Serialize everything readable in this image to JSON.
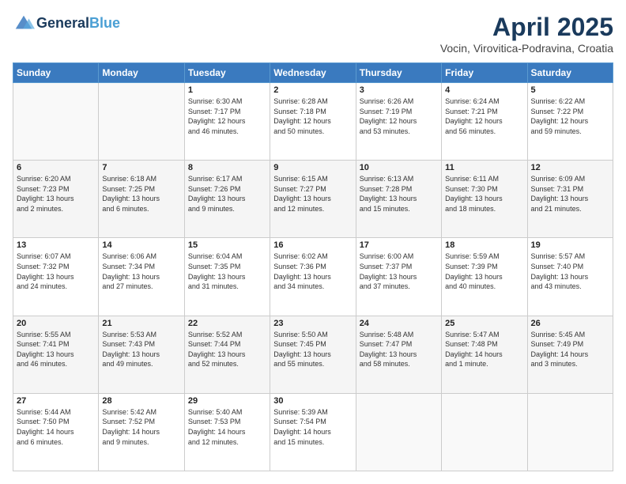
{
  "header": {
    "logo_line1": "General",
    "logo_line2": "Blue",
    "title": "April 2025",
    "subtitle": "Vocin, Virovitica-Podravina, Croatia"
  },
  "days_of_week": [
    "Sunday",
    "Monday",
    "Tuesday",
    "Wednesday",
    "Thursday",
    "Friday",
    "Saturday"
  ],
  "weeks": [
    [
      {
        "day": "",
        "info": ""
      },
      {
        "day": "",
        "info": ""
      },
      {
        "day": "1",
        "info": "Sunrise: 6:30 AM\nSunset: 7:17 PM\nDaylight: 12 hours\nand 46 minutes."
      },
      {
        "day": "2",
        "info": "Sunrise: 6:28 AM\nSunset: 7:18 PM\nDaylight: 12 hours\nand 50 minutes."
      },
      {
        "day": "3",
        "info": "Sunrise: 6:26 AM\nSunset: 7:19 PM\nDaylight: 12 hours\nand 53 minutes."
      },
      {
        "day": "4",
        "info": "Sunrise: 6:24 AM\nSunset: 7:21 PM\nDaylight: 12 hours\nand 56 minutes."
      },
      {
        "day": "5",
        "info": "Sunrise: 6:22 AM\nSunset: 7:22 PM\nDaylight: 12 hours\nand 59 minutes."
      }
    ],
    [
      {
        "day": "6",
        "info": "Sunrise: 6:20 AM\nSunset: 7:23 PM\nDaylight: 13 hours\nand 2 minutes."
      },
      {
        "day": "7",
        "info": "Sunrise: 6:18 AM\nSunset: 7:25 PM\nDaylight: 13 hours\nand 6 minutes."
      },
      {
        "day": "8",
        "info": "Sunrise: 6:17 AM\nSunset: 7:26 PM\nDaylight: 13 hours\nand 9 minutes."
      },
      {
        "day": "9",
        "info": "Sunrise: 6:15 AM\nSunset: 7:27 PM\nDaylight: 13 hours\nand 12 minutes."
      },
      {
        "day": "10",
        "info": "Sunrise: 6:13 AM\nSunset: 7:28 PM\nDaylight: 13 hours\nand 15 minutes."
      },
      {
        "day": "11",
        "info": "Sunrise: 6:11 AM\nSunset: 7:30 PM\nDaylight: 13 hours\nand 18 minutes."
      },
      {
        "day": "12",
        "info": "Sunrise: 6:09 AM\nSunset: 7:31 PM\nDaylight: 13 hours\nand 21 minutes."
      }
    ],
    [
      {
        "day": "13",
        "info": "Sunrise: 6:07 AM\nSunset: 7:32 PM\nDaylight: 13 hours\nand 24 minutes."
      },
      {
        "day": "14",
        "info": "Sunrise: 6:06 AM\nSunset: 7:34 PM\nDaylight: 13 hours\nand 27 minutes."
      },
      {
        "day": "15",
        "info": "Sunrise: 6:04 AM\nSunset: 7:35 PM\nDaylight: 13 hours\nand 31 minutes."
      },
      {
        "day": "16",
        "info": "Sunrise: 6:02 AM\nSunset: 7:36 PM\nDaylight: 13 hours\nand 34 minutes."
      },
      {
        "day": "17",
        "info": "Sunrise: 6:00 AM\nSunset: 7:37 PM\nDaylight: 13 hours\nand 37 minutes."
      },
      {
        "day": "18",
        "info": "Sunrise: 5:59 AM\nSunset: 7:39 PM\nDaylight: 13 hours\nand 40 minutes."
      },
      {
        "day": "19",
        "info": "Sunrise: 5:57 AM\nSunset: 7:40 PM\nDaylight: 13 hours\nand 43 minutes."
      }
    ],
    [
      {
        "day": "20",
        "info": "Sunrise: 5:55 AM\nSunset: 7:41 PM\nDaylight: 13 hours\nand 46 minutes."
      },
      {
        "day": "21",
        "info": "Sunrise: 5:53 AM\nSunset: 7:43 PM\nDaylight: 13 hours\nand 49 minutes."
      },
      {
        "day": "22",
        "info": "Sunrise: 5:52 AM\nSunset: 7:44 PM\nDaylight: 13 hours\nand 52 minutes."
      },
      {
        "day": "23",
        "info": "Sunrise: 5:50 AM\nSunset: 7:45 PM\nDaylight: 13 hours\nand 55 minutes."
      },
      {
        "day": "24",
        "info": "Sunrise: 5:48 AM\nSunset: 7:47 PM\nDaylight: 13 hours\nand 58 minutes."
      },
      {
        "day": "25",
        "info": "Sunrise: 5:47 AM\nSunset: 7:48 PM\nDaylight: 14 hours\nand 1 minute."
      },
      {
        "day": "26",
        "info": "Sunrise: 5:45 AM\nSunset: 7:49 PM\nDaylight: 14 hours\nand 3 minutes."
      }
    ],
    [
      {
        "day": "27",
        "info": "Sunrise: 5:44 AM\nSunset: 7:50 PM\nDaylight: 14 hours\nand 6 minutes."
      },
      {
        "day": "28",
        "info": "Sunrise: 5:42 AM\nSunset: 7:52 PM\nDaylight: 14 hours\nand 9 minutes."
      },
      {
        "day": "29",
        "info": "Sunrise: 5:40 AM\nSunset: 7:53 PM\nDaylight: 14 hours\nand 12 minutes."
      },
      {
        "day": "30",
        "info": "Sunrise: 5:39 AM\nSunset: 7:54 PM\nDaylight: 14 hours\nand 15 minutes."
      },
      {
        "day": "",
        "info": ""
      },
      {
        "day": "",
        "info": ""
      },
      {
        "day": "",
        "info": ""
      }
    ]
  ]
}
